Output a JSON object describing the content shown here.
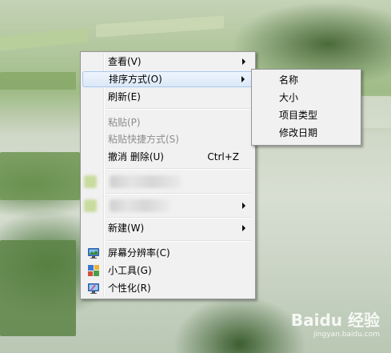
{
  "context_menu": {
    "items": [
      {
        "label": "查看(V)"
      },
      {
        "label": "排序方式(O)"
      },
      {
        "label": "刷新(E)"
      },
      {
        "label": "粘贴(P)"
      },
      {
        "label": "粘贴快捷方式(S)"
      },
      {
        "label": "撤消 删除(U)",
        "shortcut": "Ctrl+Z"
      },
      {
        "label": "新建(W)"
      },
      {
        "label": "屏幕分辨率(C)"
      },
      {
        "label": "小工具(G)"
      },
      {
        "label": "个性化(R)"
      }
    ]
  },
  "sort_submenu": {
    "items": [
      {
        "label": "名称"
      },
      {
        "label": "大小"
      },
      {
        "label": "项目类型"
      },
      {
        "label": "修改日期"
      }
    ]
  },
  "watermark": {
    "logo": "Baidu 经验",
    "url": "jingyan.baidu.com"
  },
  "icons": {
    "screen_resolution": "monitor-icon",
    "gadgets": "gadgets-icon",
    "personalize": "personalize-icon"
  },
  "colors": {
    "hover_bg": "#dbe8f8",
    "hover_border": "#a8c8f0",
    "menu_bg": "#f1f1f1",
    "disabled_text": "#8d8d8d"
  }
}
